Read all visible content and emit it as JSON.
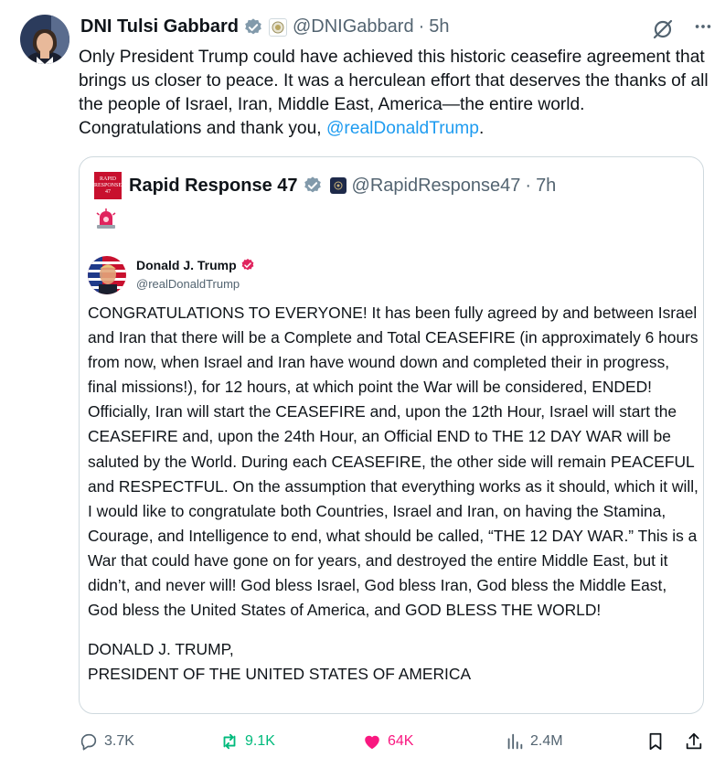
{
  "post": {
    "author_name": "DNI Tulsi Gabbard",
    "handle": "@DNIGabbard",
    "separator": "·",
    "time": "5h",
    "text_main": "Only President Trump could have achieved this historic ceasefire agreement that brings us closer to peace. It was a herculean effort that deserves the thanks of all the people of Israel, Iran, Middle East, America—the entire world. Congratulations and thank you, ",
    "mention": "@realDonaldTrump",
    "text_end": ".",
    "icons": [
      "verified-badge-icon",
      "affiliation-badge-icon",
      "grok-icon",
      "more-icon"
    ]
  },
  "quote": {
    "author_name": "Rapid Response 47",
    "handle": "@RapidResponse47",
    "separator": "·",
    "time": "7h",
    "logo_text": [
      "RAPID",
      "RESPONSE",
      "47"
    ],
    "siren_emoji": "siren-icon",
    "inner": {
      "author_name": "Donald J. Trump",
      "handle": "@realDonaldTrump",
      "body": "CONGRATULATIONS TO EVERYONE! It has been fully agreed by and between Israel and Iran that there will be a Complete and Total CEASEFIRE (in approximately 6 hours from now, when Israel and Iran have wound down and completed their in progress, final missions!), for 12 hours, at which point the War will be considered, ENDED! Officially, Iran will start the CEASEFIRE and, upon the 12th Hour, Israel will start the CEASEFIRE and, upon the 24th Hour, an Official END to THE 12 DAY WAR will be saluted by the World. During each CEASEFIRE, the other side will remain PEACEFUL and RESPECTFUL. On the assumption that everything works as it should, which it will, I would like to congratulate both Countries, Israel and Iran, on having the Stamina, Courage, and Intelligence to end, what should be called, “THE 12 DAY WAR.” This is a War that could have gone on for years, and destroyed the entire Middle East, but it didn’t, and never will! God bless Israel, God bless Iran, God bless the Middle East, God bless the United States of America, and GOD BLESS THE WORLD!",
      "signature_line1": "DONALD J. TRUMP,",
      "signature_line2": "PRESIDENT OF THE UNITED STATES OF AMERICA"
    }
  },
  "actions": {
    "replies": "3.7K",
    "reposts": "9.1K",
    "likes": "64K",
    "views": "2.4M"
  },
  "colors": {
    "accent": "#1d9bf0",
    "repost": "#00ba7c",
    "like": "#f91880",
    "muted": "#536471",
    "text": "#0f1419",
    "border": "#cfd9de"
  }
}
